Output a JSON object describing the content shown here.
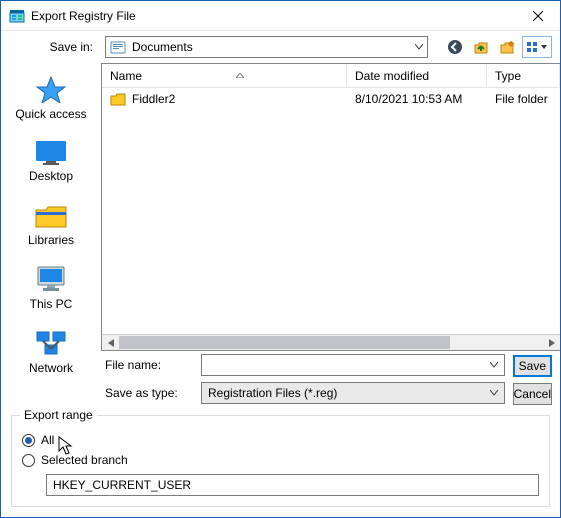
{
  "window": {
    "title": "Export Registry File"
  },
  "toolbar": {
    "save_in_label": "Save in:",
    "location_name": "Documents"
  },
  "places": [
    {
      "id": "quick-access",
      "label": "Quick access"
    },
    {
      "id": "desktop",
      "label": "Desktop"
    },
    {
      "id": "libraries",
      "label": "Libraries"
    },
    {
      "id": "this-pc",
      "label": "This PC"
    },
    {
      "id": "network",
      "label": "Network"
    }
  ],
  "columns": {
    "name": "Name",
    "date": "Date modified",
    "type": "Type"
  },
  "files": [
    {
      "name": "Fiddler2",
      "date": "8/10/2021 10:53 AM",
      "type": "File folder"
    }
  ],
  "form": {
    "file_name_label": "File name:",
    "file_name_value": "",
    "save_type_label": "Save as type:",
    "save_type_value": "Registration Files (*.reg)",
    "save_button": "Save",
    "cancel_button": "Cancel"
  },
  "export": {
    "legend": "Export range",
    "all_label": "All",
    "selected_label": "Selected branch",
    "selected_value": "HKEY_CURRENT_USER",
    "checked": "all"
  }
}
